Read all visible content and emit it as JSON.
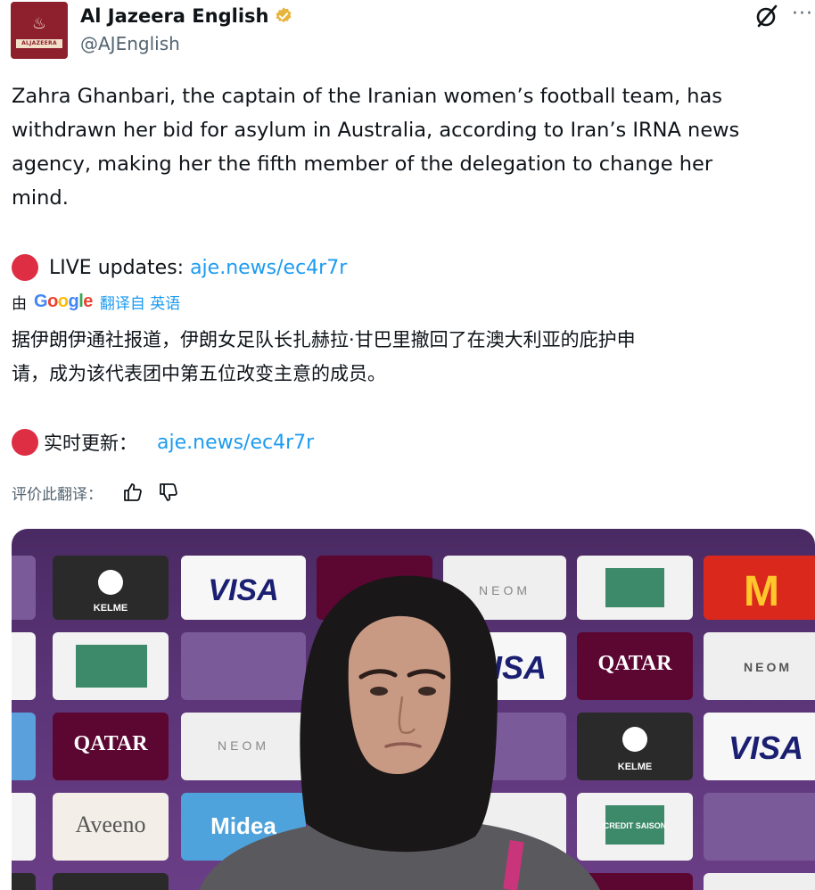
{
  "author": {
    "display_name": "Al Jazeera English",
    "handle": "@AJEnglish",
    "avatar_text": "ALJAZEERA",
    "verified_color": "#e8b339"
  },
  "icons": {
    "verified": "verified-badge-icon",
    "grok": "grok-icon",
    "more": "more-options-icon",
    "thumb_up": "thumbs-up-icon",
    "thumb_down": "thumbs-down-icon",
    "live_dot": "red-circle-icon"
  },
  "tweet": {
    "text_lines": [
      "Zahra Ghanbari, the captain of the Iranian women’s football team, has",
      "withdrawn her bid for asylum in Australia, according to Iran’s IRNA news",
      "agency, making her the fifth member of the delegation to change her",
      "mind."
    ],
    "live_label": "LIVE updates: ",
    "live_link": "aje.news/ec4r7r"
  },
  "translation": {
    "by": "由",
    "google": [
      "G",
      "o",
      "o",
      "g",
      "l",
      "e"
    ],
    "from_label": "翻译自 英语",
    "text_lines": [
      "据伊朗伊通社报道，伊朗女足队长扎赫拉·甘巴里撤回了在澳大利亚的庇护申",
      "请，成为该代表团中第五位改变主意的成员。"
    ],
    "live_label": "实时更新：",
    "live_link": "aje.news/ec4r7r",
    "rate_label": "评价此翻译："
  },
  "photo": {
    "sponsor_boards": [
      "VISA",
      "QATAR",
      "NEOM",
      "KELME",
      "CREDIT SAISON",
      "Aveeno",
      "Midea"
    ],
    "accent_colors": {
      "backdrop": "#5b3578",
      "visa_blue": "#1a1f71",
      "mcdonalds_red": "#da291c",
      "mcdonalds_yellow": "#ffc72c",
      "qatar_maroon": "#5c0632"
    }
  }
}
